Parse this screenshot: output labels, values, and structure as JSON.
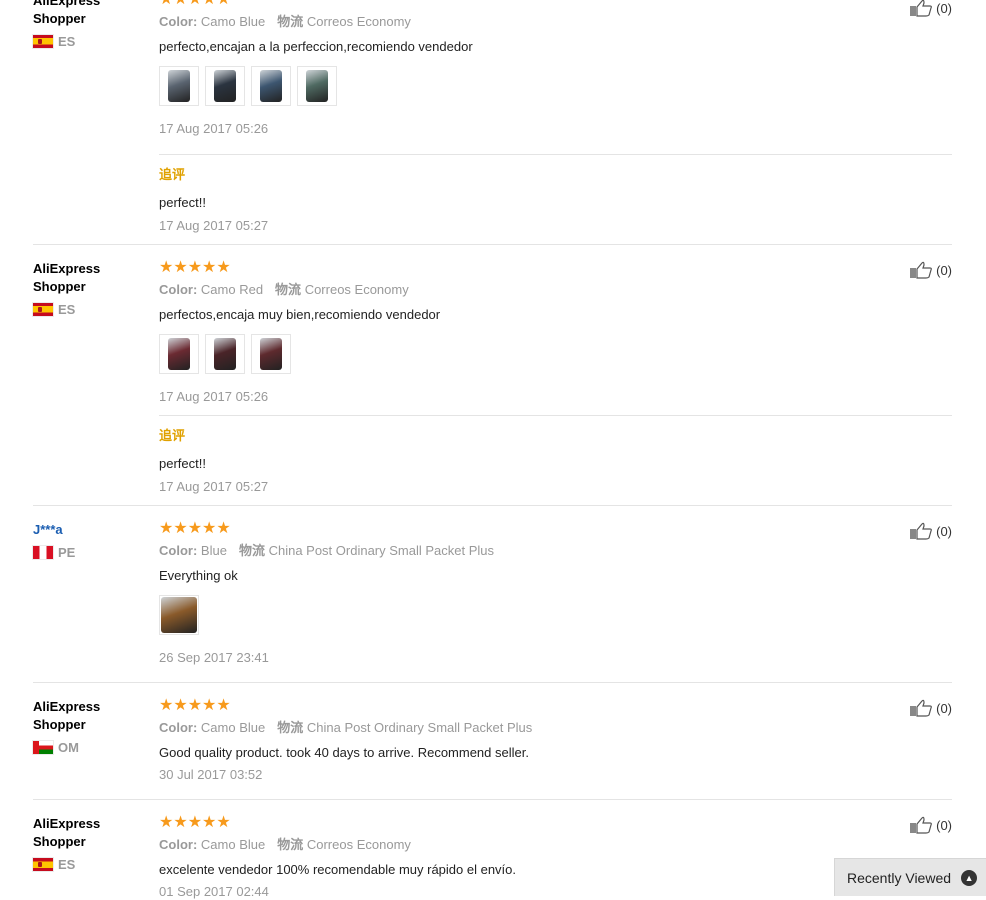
{
  "labels": {
    "color_label": "Color:",
    "shipping_label": "物流",
    "followup_label": "追评",
    "recently_viewed": "Recently Viewed"
  },
  "reviews": [
    {
      "user": "AliExpress Shopper",
      "country": "ES",
      "stars": "★★★★★",
      "color": "Camo Blue",
      "shipping": "Correos Economy",
      "text": "perfecto,encajan a la perfeccion,recomiendo vendedor",
      "photo_colors": [
        "#5a6470",
        "#2b3440",
        "#3d5670",
        "#4f6a62"
      ],
      "date": "17 Aug 2017 05:26",
      "followup": {
        "text": "perfect!!",
        "date": "17 Aug 2017 05:27"
      },
      "helpful": "(0)"
    },
    {
      "user": "AliExpress Shopper",
      "country": "ES",
      "stars": "★★★★★",
      "color": "Camo Red",
      "shipping": "Correos Economy",
      "text": "perfectos,encaja muy bien,recomiendo vendedor",
      "photo_colors": [
        "#6b2a32",
        "#4a2428",
        "#5e2a2e"
      ],
      "date": "17 Aug 2017 05:26",
      "followup": {
        "text": "perfect!!",
        "date": "17 Aug 2017 05:27"
      },
      "helpful": "(0)"
    },
    {
      "user": "J***a",
      "country": "PE",
      "stars": "★★★★★",
      "color": "Blue",
      "shipping": "China Post Ordinary Small Packet Plus",
      "text": "Everything ok",
      "photo_colors": [
        "#8a5a2a"
      ],
      "date": "26 Sep 2017 23:41",
      "helpful": "(0)"
    },
    {
      "user": "AliExpress Shopper",
      "country": "OM",
      "stars": "★★★★★",
      "color": "Camo Blue",
      "shipping": "China Post Ordinary Small Packet Plus",
      "text": "Good quality product. took 40 days to arrive. Recommend seller.",
      "date": "30 Jul 2017 03:52",
      "helpful": "(0)"
    },
    {
      "user": "AliExpress Shopper",
      "country": "ES",
      "stars": "★★★★★",
      "color": "Camo Blue",
      "shipping": "Correos Economy",
      "text": "excelente vendedor 100% recomendable muy rápido el envío.",
      "date": "01 Sep 2017 02:44",
      "helpful": "(0)"
    }
  ],
  "colors": {
    "star": "#f79a1c",
    "followup_label": "#e0a100",
    "username_link": "#1a5db1"
  },
  "icons": [
    "thumbs-up-icon",
    "chevron-up-icon",
    "flag-es-icon",
    "flag-pe-icon",
    "flag-om-icon"
  ]
}
